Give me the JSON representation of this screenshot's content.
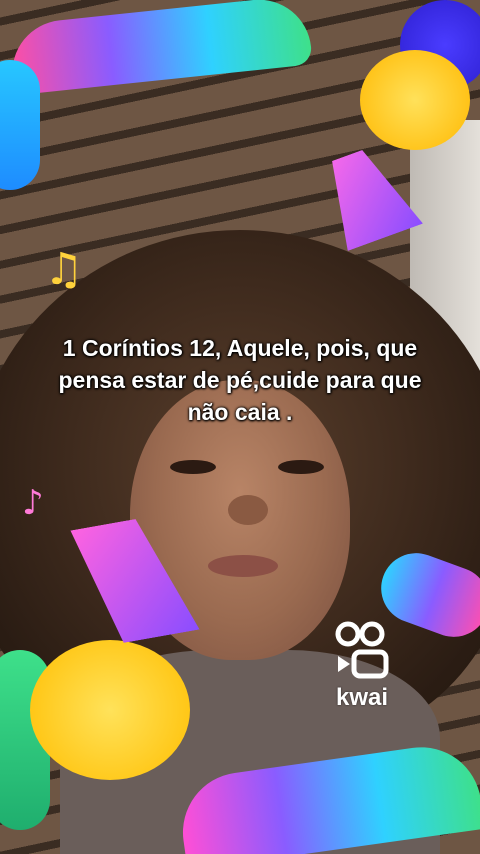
{
  "caption": {
    "text": "1 Coríntios 12, Aquele, pois, que pensa estar de pé,cuide para que não caia ."
  },
  "watermark": {
    "icon": "kwai-logo-icon",
    "label": "kwai"
  },
  "decorations": {
    "icons": [
      "music-note-icon",
      "music-note-icon",
      "trumpet-icon",
      "trumpet-icon"
    ],
    "colors": {
      "pink": "#ff4fa3",
      "purple": "#8a5cff",
      "cyan": "#2fd1ff",
      "green": "#3ee08a",
      "yellow": "#ffd23c"
    }
  }
}
